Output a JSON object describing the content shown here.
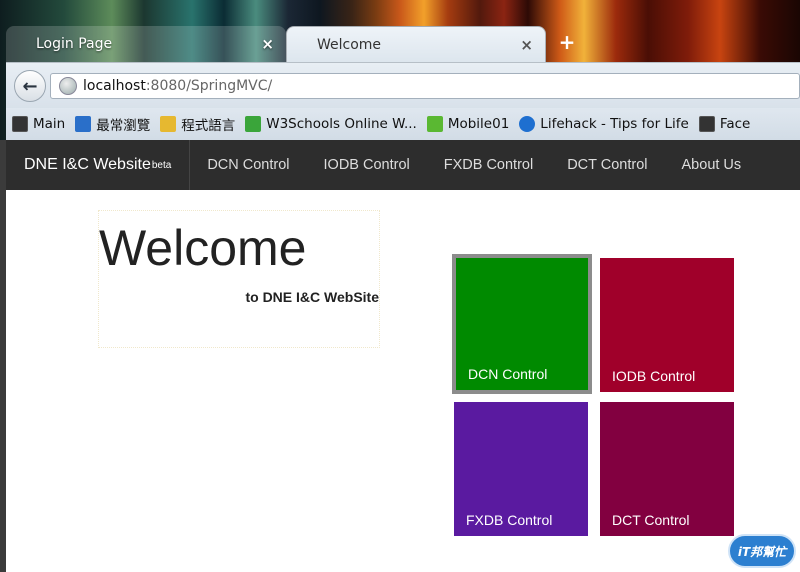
{
  "browser": {
    "tabs": [
      {
        "label": "Login Page",
        "close": "×"
      },
      {
        "label": "Welcome",
        "close": "×"
      }
    ],
    "new_tab": "+",
    "back": "←",
    "url_host": "localhost",
    "url_rest": ":8080/SpringMVC/",
    "bookmarks": [
      {
        "label": "Main",
        "icon": "page-icon",
        "color": "#333333"
      },
      {
        "label": "最常瀏覽",
        "icon": "search-icon",
        "color": "#2a6fc9"
      },
      {
        "label": "程式語言",
        "icon": "folder-icon",
        "color": "#e6b830"
      },
      {
        "label": "W3Schools Online W...",
        "icon": "w3schools-icon",
        "color": "#3aa53a"
      },
      {
        "label": "Mobile01",
        "icon": "mobile01-icon",
        "color": "#5ab832"
      },
      {
        "label": "Lifehack - Tips for Life",
        "icon": "lifehack-icon",
        "color": "#1e6fd0"
      },
      {
        "label": "Face",
        "icon": "page-icon",
        "color": "#333333"
      }
    ]
  },
  "site": {
    "brand": "DNE I&C Website",
    "brand_sup": "beta",
    "nav": [
      "DCN Control",
      "IODB Control",
      "FXDB Control",
      "DCT Control",
      "About Us"
    ],
    "hero_title": "Welcome",
    "hero_subtitle": "to DNE I&C WebSite",
    "tiles": [
      {
        "label": "DCN Control",
        "color": "#008a00"
      },
      {
        "label": "IODB Control",
        "color": "#a0002a"
      },
      {
        "label": "FXDB Control",
        "color": "#5a1aa0"
      },
      {
        "label": "DCT Control",
        "color": "#820040"
      }
    ]
  },
  "watermark": "iT邦幫忙"
}
